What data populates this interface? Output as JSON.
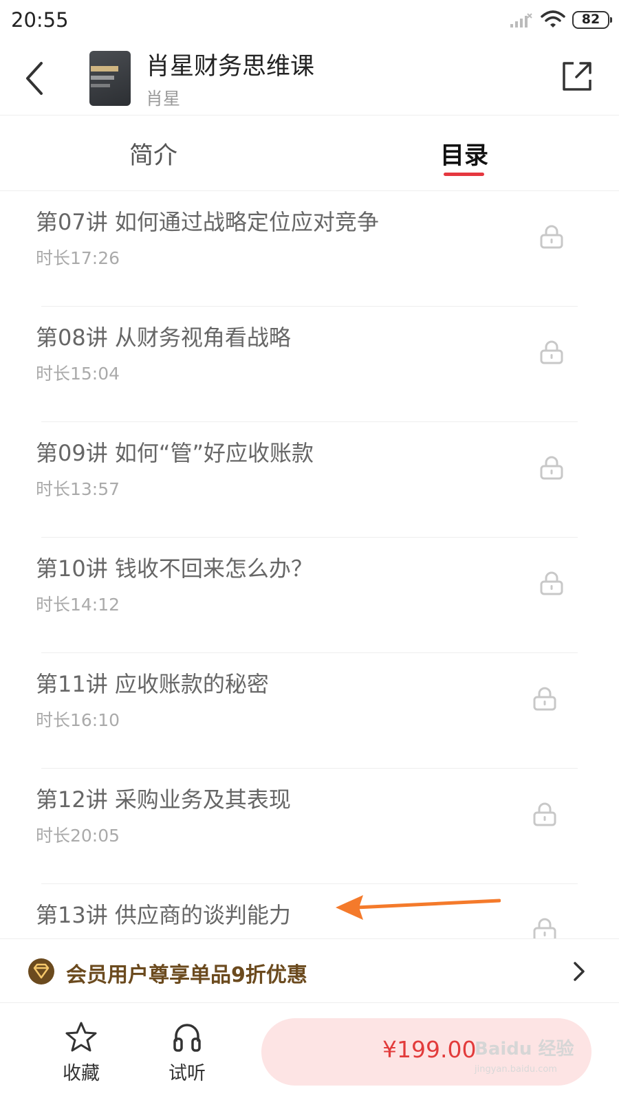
{
  "status_bar": {
    "time": "20:55",
    "battery": "82"
  },
  "header": {
    "course_title": "肖星财务思维课",
    "author": "肖星"
  },
  "tabs": [
    {
      "label": "简介",
      "active": false
    },
    {
      "label": "目录",
      "active": true
    }
  ],
  "lessons": [
    {
      "title": "第07讲 如何通过战略定位应对竞争",
      "duration": "时长17:26",
      "locked": true
    },
    {
      "title": "第08讲 从财务视角看战略",
      "duration": "时长15:04",
      "locked": true
    },
    {
      "title": "第09讲 如何“管”好应收账款",
      "duration": "时长13:57",
      "locked": true
    },
    {
      "title": "第10讲 钱收不回来怎么办？",
      "duration": "时长14:12",
      "locked": true
    },
    {
      "title": "第11讲 应收账款的秘密",
      "duration": "时长16:10",
      "locked": true
    },
    {
      "title": "第12讲 采购业务及其表现",
      "duration": "时长20:05",
      "locked": true
    },
    {
      "title": "第13讲 供应商的谈判能力",
      "duration": "",
      "locked": true
    }
  ],
  "member_banner": {
    "text": "会员用户尊享单品9折优惠"
  },
  "bottom_bar": {
    "favorite_label": "收藏",
    "trial_label": "试听",
    "price": "¥199.00"
  },
  "watermark": {
    "text": "Baidu 经验",
    "url": "jingyan.baidu.com"
  },
  "colors": {
    "accent_red": "#e5373f",
    "price_red": "#e23b3b",
    "buy_bg": "#fde4e4",
    "member_gold": "#6b4a1e",
    "annotation_arrow": "#f47a2b"
  },
  "icons": [
    "back-icon",
    "share-icon",
    "lock-icon",
    "member-badge-icon",
    "chevron-right-icon",
    "star-icon",
    "headphones-icon",
    "signal-icon",
    "wifi-icon"
  ]
}
